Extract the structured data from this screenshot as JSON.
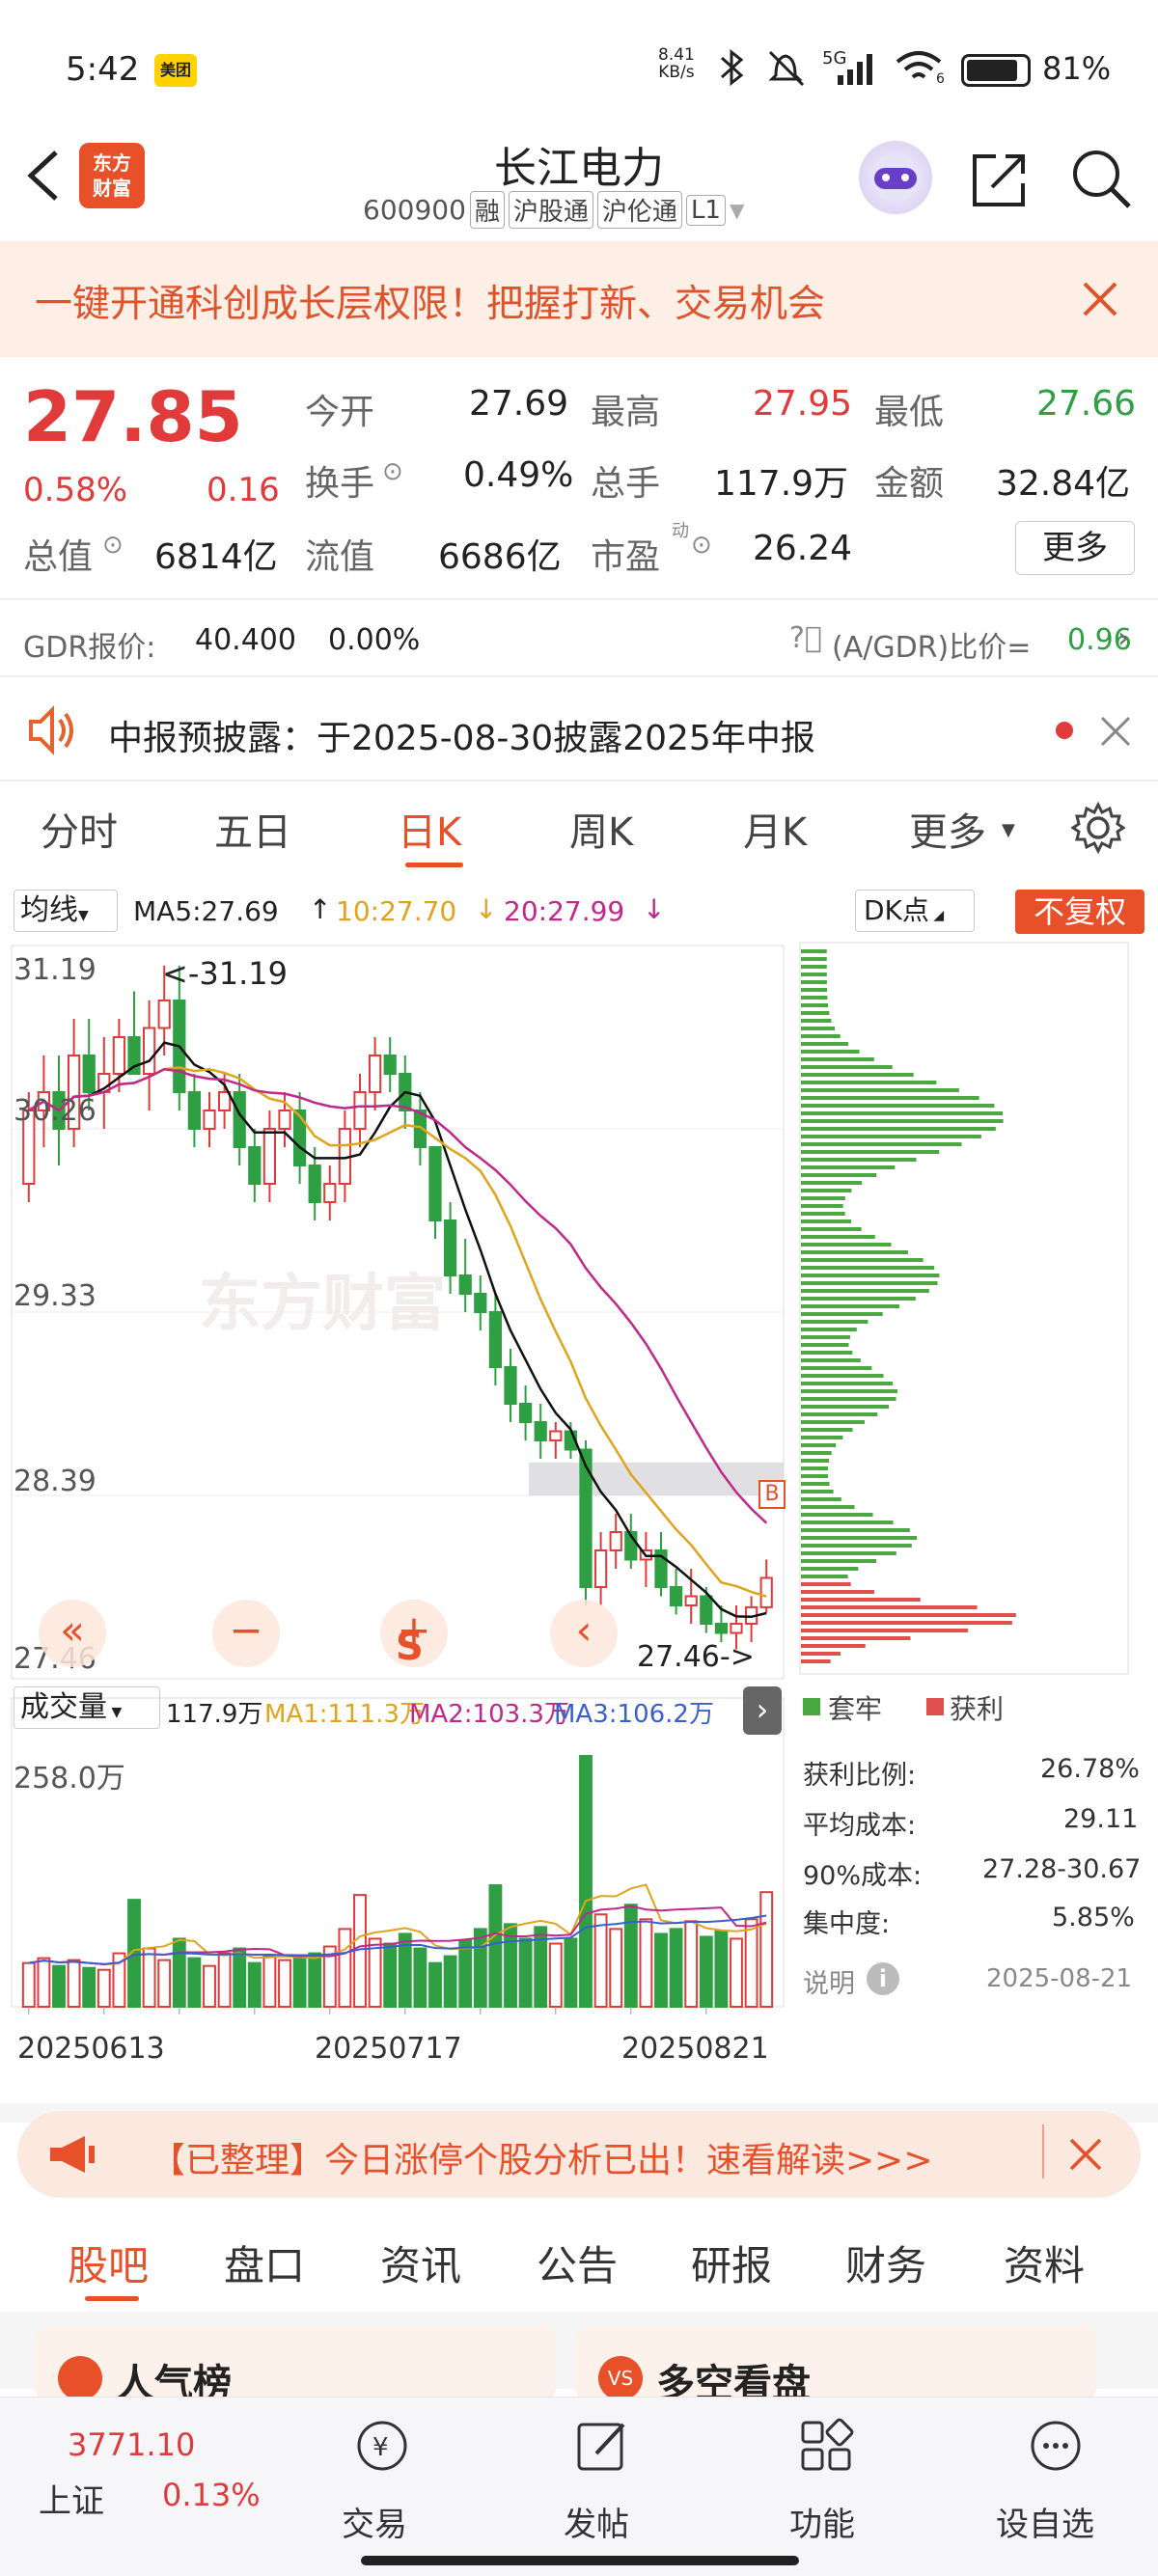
{
  "status_bar": {
    "time": "5:42",
    "app_badge": "美团",
    "net_speed_value": "8.41",
    "net_speed_unit": "KB/s",
    "network": "5G",
    "wifi_num": "6",
    "battery": "81%"
  },
  "header": {
    "back_label": "<",
    "logo_line1": "东方",
    "logo_line2": "财富",
    "name": "长江电力",
    "code": "600900",
    "tags": [
      "融",
      "沪股通",
      "沪伦通",
      "L1"
    ]
  },
  "promo_banner": {
    "text": "一键开通科创成长层权限！把握打新、交易机会"
  },
  "quote": {
    "price": "27.85",
    "pct": "0.58%",
    "change": "0.16",
    "open_label": "今开",
    "open": "27.69",
    "high_label": "最高",
    "high": "27.95",
    "low_label": "最低",
    "low": "27.66",
    "turnover_label": "换手",
    "turnover": "0.49%",
    "volume_label": "总手",
    "volume": "117.9万",
    "amount_label": "金额",
    "amount": "32.84亿",
    "mktcap_label": "总值",
    "mktcap": "6814亿",
    "float_label": "流值",
    "float": "6686亿",
    "pe_label": "市盈",
    "pe_sup": "动",
    "pe": "26.24",
    "more_label": "更多"
  },
  "gdr": {
    "label": "GDR报价:",
    "price": "40.400",
    "pct": "0.00%",
    "ratio_label": "(A/GDR)比价=",
    "ratio": "0.96"
  },
  "notice": {
    "text": "中报预披露：于2025-08-30披露2025年中报"
  },
  "chart_tabs": [
    "分时",
    "五日",
    "日K",
    "周K",
    "月K",
    "更多"
  ],
  "ma_bar": {
    "selector": "均线",
    "ma5": "MA5:27.69",
    "ma10": "10:27.70",
    "ma20": "20:27.99",
    "dk": "DK点",
    "adjust": "不复权"
  },
  "kline": {
    "price_ticks": [
      "31.19",
      "30.26",
      "29.33",
      "28.39",
      "27.46"
    ],
    "max_label": "<-31.19",
    "min_label": "27.46->",
    "marker_b": "B",
    "marker_s": "S",
    "watermark": "东方财富"
  },
  "volume_bar": {
    "selector": "成交量",
    "vol": "117.9万",
    "ma1": "MA1:111.3万",
    "ma2": "MA2:103.3万",
    "ma3": "MA3:106.2万",
    "max_label": "258.0万"
  },
  "dates": [
    "20250613",
    "20250717",
    "20250821"
  ],
  "chip": {
    "legend_trap": "套牢",
    "legend_profit": "获利",
    "rows": [
      {
        "label": "获利比例:",
        "value": "26.78%"
      },
      {
        "label": "平均成本:",
        "value": "29.11"
      },
      {
        "label": "90%成本:",
        "value": "27.28-30.67"
      },
      {
        "label": "集中度:",
        "value": "5.85%"
      }
    ],
    "note_label": "说明",
    "date": "2025-08-21"
  },
  "ad_banner": {
    "text": "【已整理】今日涨停个股分析已出！速看解读>>>"
  },
  "section_tabs": [
    "股吧",
    "盘口",
    "资讯",
    "公告",
    "研报",
    "财务",
    "资料"
  ],
  "cards": [
    {
      "title": "人气榜"
    },
    {
      "title": "多空看盘"
    }
  ],
  "bottom_nav": {
    "index_value": "3771.10",
    "index_name": "上证",
    "index_pct": "0.13%",
    "items": [
      "交易",
      "发帖",
      "功能",
      "设自选"
    ]
  },
  "chart_data": {
    "type": "candlestick",
    "title": "长江电力 日K",
    "x_start": "20250613",
    "x_mid": "20250717",
    "x_end": "20250821",
    "ylim": [
      27.46,
      31.19
    ],
    "ohlc": [
      [
        30.0,
        30.5,
        29.9,
        30.4
      ],
      [
        30.4,
        30.7,
        30.2,
        30.5
      ],
      [
        30.5,
        30.7,
        30.1,
        30.3
      ],
      [
        30.3,
        30.9,
        30.2,
        30.7
      ],
      [
        30.7,
        30.9,
        30.4,
        30.5
      ],
      [
        30.5,
        30.8,
        30.3,
        30.6
      ],
      [
        30.6,
        30.9,
        30.5,
        30.8
      ],
      [
        30.8,
        31.05,
        30.6,
        30.6
      ],
      [
        30.6,
        31.0,
        30.4,
        30.85
      ],
      [
        30.85,
        31.19,
        30.7,
        31.0
      ],
      [
        31.0,
        31.19,
        30.4,
        30.5
      ],
      [
        30.5,
        30.6,
        30.2,
        30.3
      ],
      [
        30.3,
        30.5,
        30.2,
        30.4
      ],
      [
        30.4,
        30.6,
        30.3,
        30.5
      ],
      [
        30.5,
        30.6,
        30.1,
        30.2
      ],
      [
        30.2,
        30.3,
        29.9,
        30.0
      ],
      [
        30.0,
        30.4,
        29.9,
        30.3
      ],
      [
        30.3,
        30.5,
        30.2,
        30.4
      ],
      [
        30.4,
        30.5,
        30.0,
        30.1
      ],
      [
        30.1,
        30.2,
        29.8,
        29.9
      ],
      [
        29.9,
        30.1,
        29.8,
        30.0
      ],
      [
        30.0,
        30.4,
        29.9,
        30.3
      ],
      [
        30.3,
        30.6,
        30.2,
        30.5
      ],
      [
        30.5,
        30.8,
        30.4,
        30.7
      ],
      [
        30.7,
        30.8,
        30.5,
        30.6
      ],
      [
        30.6,
        30.7,
        30.3,
        30.4
      ],
      [
        30.4,
        30.5,
        30.1,
        30.2
      ],
      [
        30.2,
        30.2,
        29.7,
        29.8
      ],
      [
        29.8,
        29.9,
        29.4,
        29.5
      ],
      [
        29.5,
        29.7,
        29.3,
        29.4
      ],
      [
        29.4,
        29.5,
        29.2,
        29.3
      ],
      [
        29.3,
        29.4,
        28.9,
        29.0
      ],
      [
        29.0,
        29.1,
        28.7,
        28.8
      ],
      [
        28.8,
        28.9,
        28.6,
        28.7
      ],
      [
        28.7,
        28.8,
        28.5,
        28.6
      ],
      [
        28.6,
        28.7,
        28.5,
        28.65
      ],
      [
        28.65,
        28.7,
        28.5,
        28.55
      ],
      [
        28.55,
        28.6,
        27.7,
        27.8
      ],
      [
        27.8,
        28.1,
        27.7,
        28.0
      ],
      [
        28.0,
        28.2,
        27.9,
        28.1
      ],
      [
        28.1,
        28.2,
        27.9,
        27.95
      ],
      [
        27.95,
        28.1,
        27.8,
        28.0
      ],
      [
        28.0,
        28.1,
        27.75,
        27.8
      ],
      [
        27.8,
        27.9,
        27.65,
        27.7
      ],
      [
        27.7,
        27.9,
        27.6,
        27.75
      ],
      [
        27.75,
        27.8,
        27.55,
        27.6
      ],
      [
        27.6,
        27.7,
        27.5,
        27.55
      ],
      [
        27.55,
        27.7,
        27.46,
        27.6
      ],
      [
        27.6,
        27.75,
        27.5,
        27.69
      ],
      [
        27.69,
        27.95,
        27.66,
        27.85
      ]
    ],
    "volume_max": 258.0,
    "volume": [
      45,
      50,
      42,
      48,
      40,
      38,
      55,
      110,
      60,
      48,
      70,
      50,
      42,
      55,
      60,
      45,
      52,
      48,
      50,
      55,
      62,
      80,
      115,
      70,
      65,
      75,
      60,
      45,
      52,
      68,
      80,
      125,
      85,
      70,
      82,
      65,
      70,
      258,
      95,
      80,
      105,
      90,
      75,
      80,
      88,
      72,
      78,
      70,
      90,
      117.9
    ]
  }
}
